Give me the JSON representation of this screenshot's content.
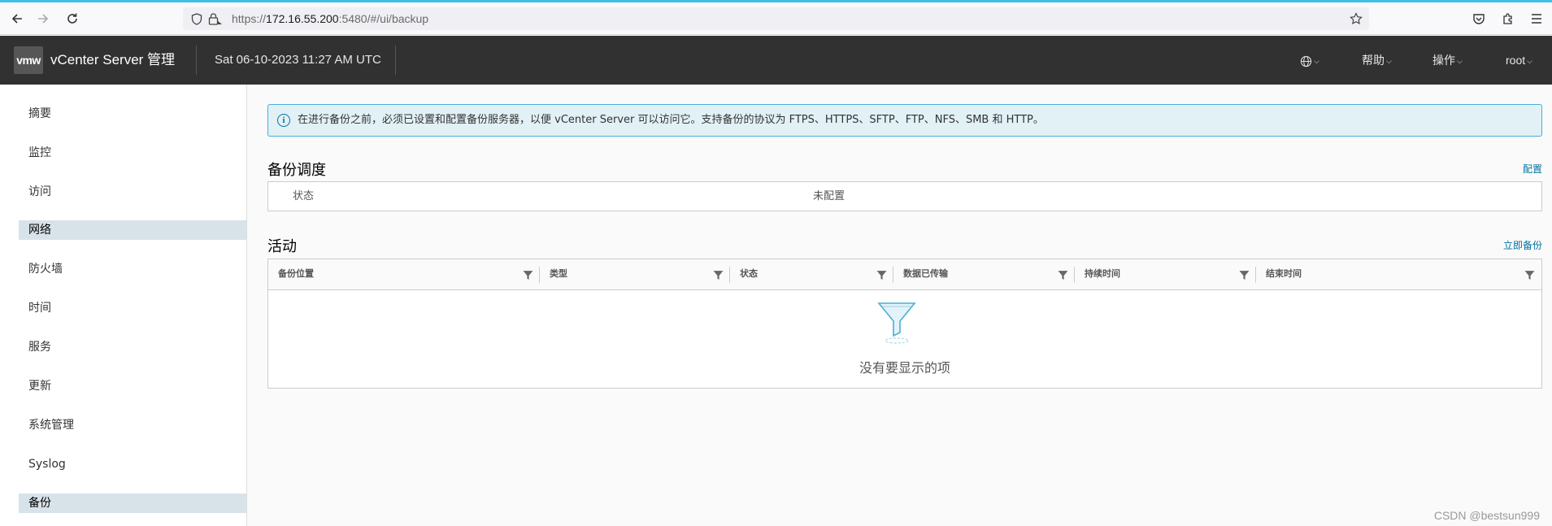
{
  "browser": {
    "url_scheme": "https://",
    "url_host": "172.16.55.200",
    "url_rest": ":5480/#/ui/backup"
  },
  "header": {
    "logo_text": "vmw",
    "app_title": "vCenter Server 管理",
    "datetime": "Sat 06-10-2023 11:27 AM UTC",
    "help_label": "帮助",
    "actions_label": "操作",
    "user_label": "root"
  },
  "sidebar": {
    "items": [
      {
        "label": "摘要",
        "active": false
      },
      {
        "label": "监控",
        "active": false
      },
      {
        "label": "访问",
        "active": false
      },
      {
        "label": "网络",
        "active": true
      },
      {
        "label": "防火墙",
        "active": false
      },
      {
        "label": "时间",
        "active": false
      },
      {
        "label": "服务",
        "active": false
      },
      {
        "label": "更新",
        "active": false
      },
      {
        "label": "系统管理",
        "active": false
      },
      {
        "label": "Syslog",
        "active": false
      },
      {
        "label": "备份",
        "active": true
      }
    ]
  },
  "alert": {
    "text": "在进行备份之前，必须已设置和配置备份服务器，以便 vCenter Server 可以访问它。支持备份的协议为 FTPS、HTTPS、SFTP、FTP、NFS、SMB 和 HTTP。"
  },
  "schedule": {
    "title": "备份调度",
    "configure_link": "配置",
    "status_label": "状态",
    "status_value": "未配置"
  },
  "activity": {
    "title": "活动",
    "backup_now_link": "立即备份",
    "columns": [
      "备份位置",
      "类型",
      "状态",
      "数据已传输",
      "持续时间",
      "结束时间"
    ],
    "empty_text": "没有要显示的项"
  },
  "watermark": "CSDN @bestsun999"
}
